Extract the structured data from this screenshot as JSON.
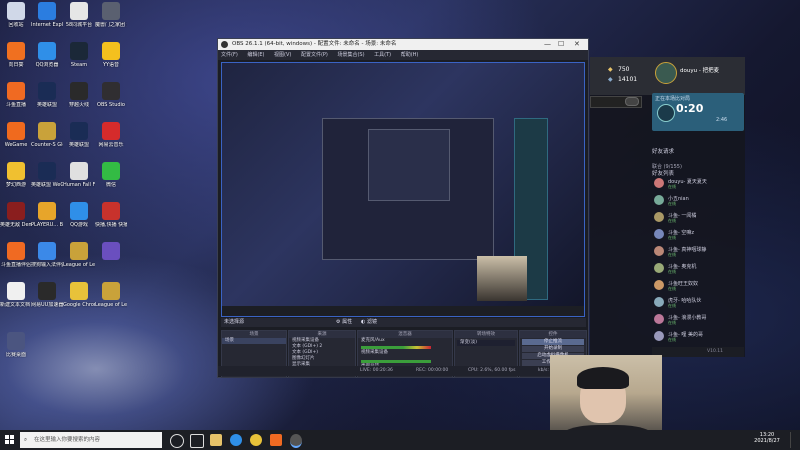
{
  "desktop_icons": [
    {
      "label": "回收站",
      "color": "#d0d8e8"
    },
    {
      "label": "Internet Explorer",
      "color": "#2b7de0"
    },
    {
      "label": "58同城平台",
      "color": "#e6e6e6"
    },
    {
      "label": "魔兽门之家团 无敌3暗巴",
      "color": "#5a6070"
    },
    {
      "label": "向日葵",
      "color": "#f07020"
    },
    {
      "label": "QQ浏览器",
      "color": "#2f8fe8"
    },
    {
      "label": "Steam",
      "color": "#1b2838"
    },
    {
      "label": "YY语音",
      "color": "#f4c01e"
    },
    {
      "label": "斗鱼直播",
      "color": "#f06a22"
    },
    {
      "label": "英雄联盟",
      "color": "#1a2c55"
    },
    {
      "label": "穿越火线",
      "color": "#2a2a2a"
    },
    {
      "label": "OBS Studio",
      "color": "#302e31"
    },
    {
      "label": "WeGame",
      "color": "#f06a1e"
    },
    {
      "label": "Counter-S Global Of...",
      "color": "#c9a23a"
    },
    {
      "label": "英雄联盟",
      "color": "#1a2c55"
    },
    {
      "label": "网易云音乐",
      "color": "#d52b2b"
    },
    {
      "label": "梦幻西游",
      "color": "#f0c030"
    },
    {
      "label": "英雄联盟 WeGame版",
      "color": "#1a2c55"
    },
    {
      "label": "Human Fall Flat",
      "color": "#e0e0e0"
    },
    {
      "label": "微信",
      "color": "#33bb44"
    },
    {
      "label": "英雄无敌 Demo",
      "color": "#8a1e1e"
    },
    {
      "label": "PLAYERU... BATTLEGR...",
      "color": "#e7a52a"
    },
    {
      "label": "QQ游戏",
      "color": "#2f8fe8"
    },
    {
      "label": "快播,快播 快播游戏",
      "color": "#c8322c"
    },
    {
      "label": "斗鱼直播伴侣",
      "color": "#f06a22"
    },
    {
      "label": "搜狗输入法伴侣",
      "color": "#3b89e8"
    },
    {
      "label": "League of Legends",
      "color": "#c9a23a"
    },
    {
      "label": "",
      "color": "#6a4fbf"
    },
    {
      "label": "新建文本文档 (2).txt",
      "color": "#f0f0f0"
    },
    {
      "label": "网易UU加速器",
      "color": "#2a2a2a"
    },
    {
      "label": "Google Chrome",
      "color": "#e8c23a"
    },
    {
      "label": "League of Legends",
      "color": "#c9a23a"
    },
    {
      "label": "比赛桌面",
      "color": "#4b5580"
    }
  ],
  "obs": {
    "title": "OBS 26.1.1 (64-bit, windows) - 配置文件: 未命名 - 场景: 未命名",
    "menu": [
      "文件(F)",
      "编辑(E)",
      "视图(V)",
      "配置文件(P)",
      "场景集合(S)",
      "工具(T)",
      "帮助(H)"
    ],
    "source_bar": "未选择源",
    "properties_btn": "属性",
    "filters_btn": "滤镜",
    "docks": {
      "scenes": {
        "title": "场景",
        "items": [
          "场景"
        ]
      },
      "sources": {
        "title": "来源",
        "items": [
          "视频采集设备",
          "文本 (GDI+) 2",
          "文本 (GDI+)",
          "图像幻灯片",
          "显示采集",
          "窗口采集",
          "显示器采集"
        ]
      },
      "mixer": {
        "title": "混音器",
        "channels": [
          "麦克风/Aux",
          "视频采集设备",
          "桌面音频"
        ]
      },
      "transitions": {
        "title": "转场特效",
        "select": "渐变(淡)"
      },
      "controls": {
        "title": "控件",
        "buttons": [
          "停止推流",
          "开始录制",
          "启动虚拟摄像机",
          "工作室模式",
          "设置",
          "退出"
        ]
      }
    },
    "status": {
      "live": "LIVE: 00:20:36",
      "rec": "REC: 00:00:00",
      "cpu": "CPU: 2.6%, 60.00 fps",
      "kbps": "kb/s: 5500"
    }
  },
  "side_panel": {
    "coins1": "750",
    "coins2": "14101",
    "username": "douyu - 把把麦",
    "live_status": "正在本场比对局",
    "timer": "0:20",
    "stream_time": "2:46",
    "friend_list": "好友列表",
    "friend_request": "好友请求",
    "group": "联合 (9/155)",
    "friends": [
      {
        "name": "douyu- 夏天夏天",
        "status": "在线",
        "color": "#c77"
      },
      {
        "name": "小五nian",
        "status": "在线",
        "color": "#7a9"
      },
      {
        "name": "斗鱼- 一闻橘",
        "status": "在线",
        "color": "#a96"
      },
      {
        "name": "斗鱼- 空嘛z",
        "status": "在线",
        "color": "#78b"
      },
      {
        "name": "斗鱼- 真神咽球静",
        "status": "在线",
        "color": "#b87"
      },
      {
        "name": "斗鱼- 奥克机",
        "status": "在线",
        "color": "#9a7"
      },
      {
        "name": "斗鱼旺王奴奴",
        "status": "在线",
        "color": "#c96"
      },
      {
        "name": "虎牙- 哈哈队伙",
        "status": "在线",
        "color": "#8ab"
      },
      {
        "name": "斗鱼- 浪漫小教哥",
        "status": "在线",
        "color": "#b79"
      },
      {
        "name": "斗鱼- 哩 美的哥",
        "status": "在线",
        "color": "#99b"
      }
    ],
    "version": "V10.11"
  },
  "taskbar": {
    "search_placeholder": "在这里输入你要搜索的内容",
    "time": "13:20",
    "date": "2021/8/27"
  }
}
